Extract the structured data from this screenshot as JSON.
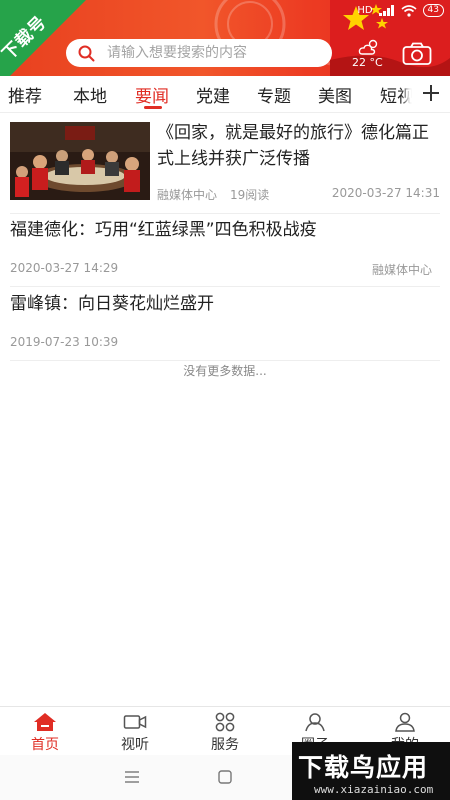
{
  "header": {
    "corner_badge": "下载号",
    "status": {
      "hd": "HD",
      "battery": "43"
    },
    "search": {
      "placeholder": "请输入想要搜索的内容"
    },
    "weather": {
      "temperature": "22 °C",
      "icon": "cloud-sun-icon"
    },
    "camera_icon": "camera-icon",
    "colors": {
      "brand": "#e02d24",
      "header_bg": "#ee4a25"
    }
  },
  "tabs": {
    "items": [
      "推荐",
      "本地",
      "要闻",
      "党建",
      "专题",
      "美图",
      "短视"
    ],
    "active": "要闻",
    "more_icon": "plus-icon"
  },
  "news": [
    {
      "title": "《回家，就是最好的旅行》德化篇正式上线并获广泛传播",
      "source": "融媒体中心",
      "reads": "19阅读",
      "time": "2020-03-27 14:31"
    },
    {
      "title": "福建德化：巧用“红蓝绿黑”四色积极战疫",
      "time": "2020-03-27 14:29",
      "source": "融媒体中心"
    },
    {
      "title": "雷峰镇：向日葵花灿烂盛开",
      "time": "2019-07-23 10:39"
    }
  ],
  "list_footer": "没有更多数据...",
  "bottom_nav": {
    "items": [
      {
        "label": "首页",
        "icon": "home-icon"
      },
      {
        "label": "视听",
        "icon": "video-icon"
      },
      {
        "label": "服务",
        "icon": "grid-icon"
      },
      {
        "label": "圈子",
        "icon": "community-icon"
      },
      {
        "label": "我的",
        "icon": "user-icon"
      }
    ],
    "active": "首页"
  },
  "watermark": {
    "text": "下载鸟应用",
    "url": "www.xiazainiao.com"
  }
}
